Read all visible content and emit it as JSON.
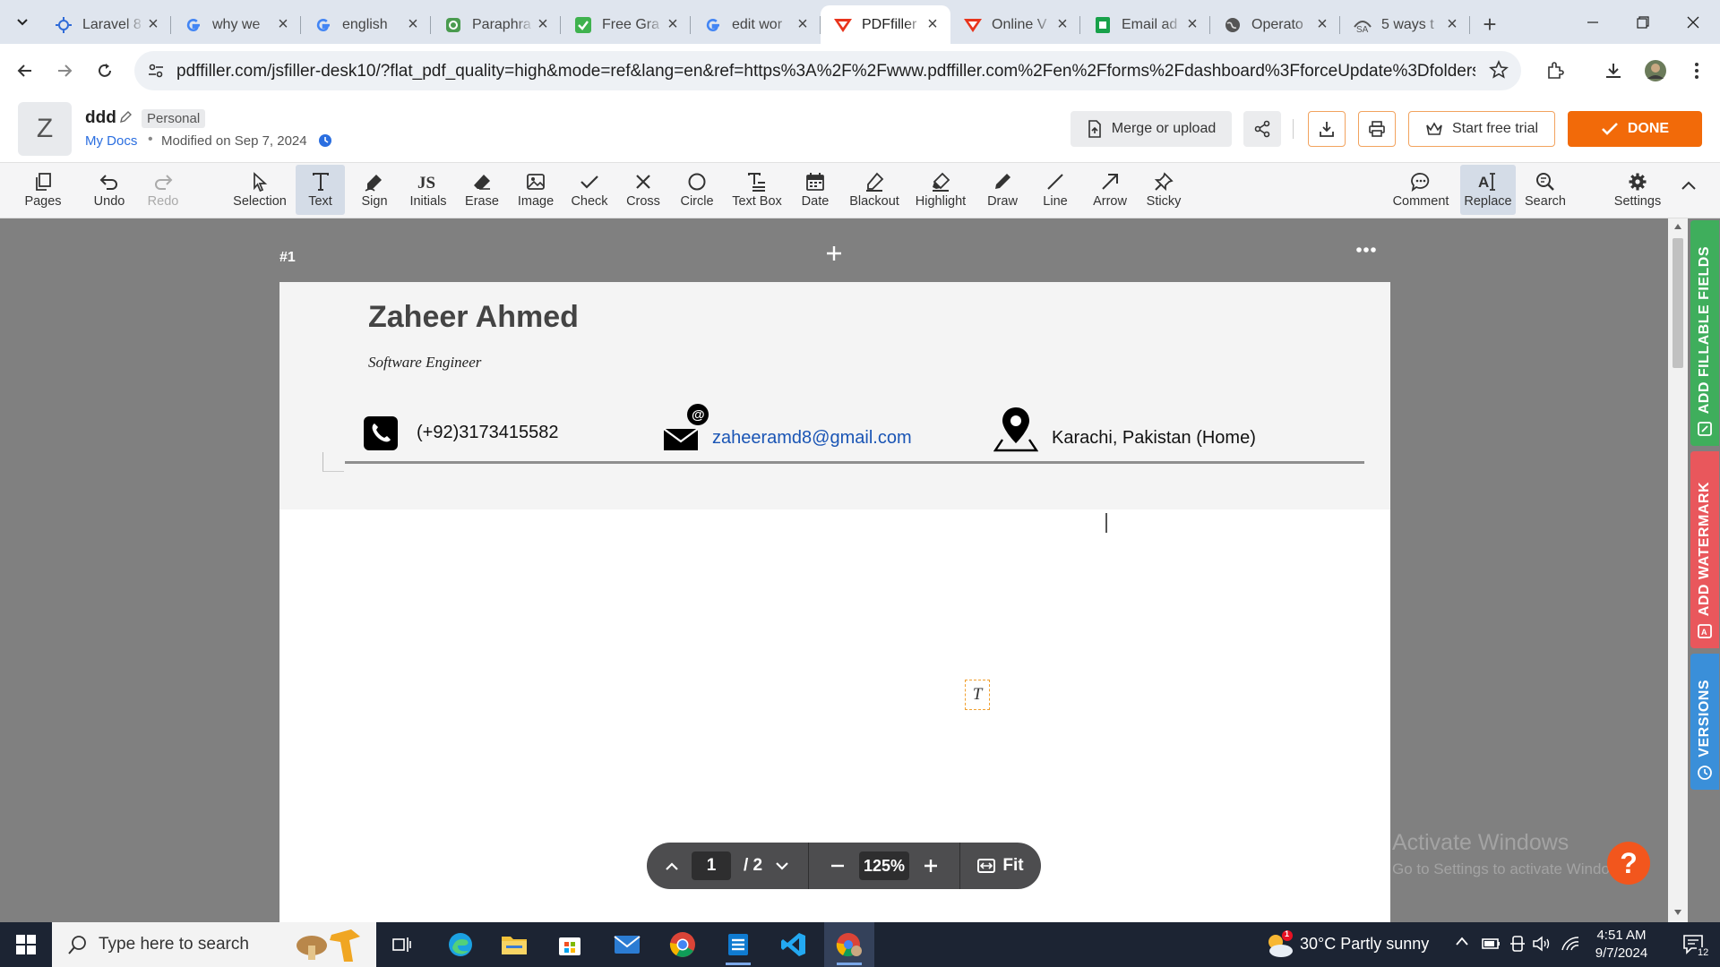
{
  "browser": {
    "tabs": [
      {
        "title": "Laravel 8",
        "icon": "gear-sun-favicon",
        "active": false
      },
      {
        "title": "why we",
        "icon": "google-favicon",
        "active": false
      },
      {
        "title": "english",
        "icon": "google-favicon",
        "active": false
      },
      {
        "title": "Paraphra",
        "icon": "quillbot-favicon",
        "active": false
      },
      {
        "title": "Free Gra",
        "icon": "grammar-check-favicon",
        "active": false
      },
      {
        "title": "edit wor",
        "icon": "google-favicon",
        "active": false
      },
      {
        "title": "PDFfiller",
        "icon": "pdffiller-favicon",
        "active": true
      },
      {
        "title": "Online V",
        "icon": "pdffiller-favicon",
        "active": false
      },
      {
        "title": "Email ad",
        "icon": "green-doc-favicon",
        "active": false
      },
      {
        "title": "Operato",
        "icon": "globe-favicon",
        "active": false
      },
      {
        "title": "5 ways t",
        "icon": "spinbot-favicon",
        "active": false
      }
    ],
    "url": "pdffiller.com/jsfiller-desk10/?flat_pdf_quality=high&mode=ref&lang=en&ref=https%3A%2F%2Fwww.pdffiller.com%2Fen%2Fforms%2Fdashboard%3FforceUpdate%3Dfolders%26selectIt..."
  },
  "header": {
    "avatar_letter": "Z",
    "doc_name": "ddd",
    "workspace": "Personal",
    "folder_link": "My Docs",
    "separator": "•",
    "modified": "Modified on Sep 7, 2024",
    "merge_label": "Merge or upload",
    "trial_label": "Start free trial",
    "done_label": "DONE",
    "accent_color": "#f26a09"
  },
  "toolbar": {
    "tools": [
      {
        "label": "Pages",
        "icon": "pages-icon"
      },
      {
        "label": "Undo",
        "icon": "undo-icon"
      },
      {
        "label": "Redo",
        "icon": "redo-icon",
        "disabled": true
      },
      {
        "label": "Selection",
        "icon": "cursor-icon"
      },
      {
        "label": "Text",
        "icon": "text-icon",
        "active": true
      },
      {
        "label": "Sign",
        "icon": "sign-icon"
      },
      {
        "label": "Initials",
        "icon": "initials-icon"
      },
      {
        "label": "Erase",
        "icon": "eraser-icon"
      },
      {
        "label": "Image",
        "icon": "image-icon"
      },
      {
        "label": "Check",
        "icon": "check-icon"
      },
      {
        "label": "Cross",
        "icon": "cross-icon"
      },
      {
        "label": "Circle",
        "icon": "circle-icon"
      },
      {
        "label": "Text Box",
        "icon": "text-box-icon"
      },
      {
        "label": "Date",
        "icon": "calendar-icon"
      },
      {
        "label": "Blackout",
        "icon": "blackout-icon"
      },
      {
        "label": "Highlight",
        "icon": "highlighter-icon"
      },
      {
        "label": "Draw",
        "icon": "pen-icon"
      },
      {
        "label": "Line",
        "icon": "line-icon"
      },
      {
        "label": "Arrow",
        "icon": "arrow-icon"
      },
      {
        "label": "Sticky",
        "icon": "pin-icon"
      },
      {
        "label": "Comment",
        "icon": "comment-icon"
      },
      {
        "label": "Replace",
        "icon": "replace-icon",
        "active": true
      },
      {
        "label": "Search",
        "icon": "search-icon"
      },
      {
        "label": "Settings",
        "icon": "gear-icon"
      }
    ]
  },
  "document": {
    "page_label": "#1",
    "name": "Zaheer Ahmed",
    "title": "Software Engineer",
    "phone": "(+92)3173415582",
    "email": "zaheeramd8@gmail.com",
    "location": "Karachi, Pakistan (Home)",
    "placeholder_glyph": "T"
  },
  "pager": {
    "current_page": "1",
    "total": "/ 2",
    "zoom": "125%",
    "fit_label": "Fit"
  },
  "rail": {
    "fillable": "ADD FILLABLE FIELDS",
    "watermark": "ADD WATERMARK",
    "versions": "VERSIONS",
    "colors": {
      "fillable": "#3fae5c",
      "watermark": "#e9575c",
      "versions": "#3a8fd9"
    }
  },
  "overlay": {
    "activate_title": "Activate Windows",
    "activate_sub": "Go to Settings to activate Windows.",
    "help_glyph": "?"
  },
  "taskbar": {
    "search_placeholder": "Type here to search",
    "weather": "30°C  Partly sunny",
    "weather_badge": "1",
    "time": "4:51 AM",
    "date": "9/7/2024",
    "notification_count": "12"
  }
}
